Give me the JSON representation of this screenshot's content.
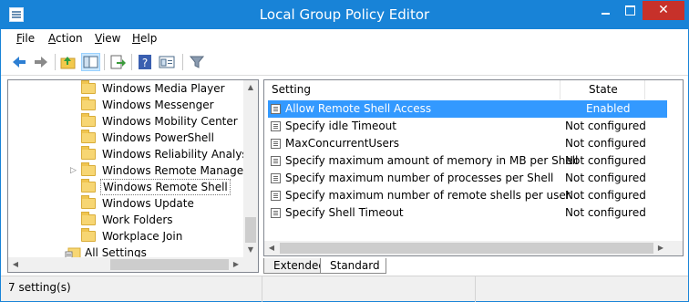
{
  "window": {
    "title": "Local Group Policy Editor",
    "accent": "#1883d7",
    "close_color": "#c7312a"
  },
  "menu": {
    "items": [
      {
        "label": "File",
        "u": "F",
        "rest": "ile"
      },
      {
        "label": "Action",
        "u": "A",
        "rest": "ction"
      },
      {
        "label": "View",
        "u": "V",
        "rest": "iew"
      },
      {
        "label": "Help",
        "u": "H",
        "rest": "elp"
      }
    ]
  },
  "toolbar": {
    "icons": [
      "back-arrow-icon",
      "forward-arrow-icon",
      "up-folder-icon",
      "show-hide-tree-icon",
      "export-list-icon",
      "help-icon",
      "properties-icon",
      "filter-icon"
    ]
  },
  "tree": {
    "items": [
      {
        "label": "Windows Media Player",
        "expandable": false
      },
      {
        "label": "Windows Messenger",
        "expandable": false
      },
      {
        "label": "Windows Mobility Center",
        "expandable": false
      },
      {
        "label": "Windows PowerShell",
        "expandable": false
      },
      {
        "label": "Windows Reliability Analysis",
        "expandable": false
      },
      {
        "label": "Windows Remote Manageme",
        "expandable": true
      },
      {
        "label": "Windows Remote Shell",
        "expandable": false,
        "selected": true
      },
      {
        "label": "Windows Update",
        "expandable": false
      },
      {
        "label": "Work Folders",
        "expandable": false
      },
      {
        "label": "Workplace Join",
        "expandable": false
      }
    ],
    "root": {
      "label": "All Settings"
    }
  },
  "list": {
    "headers": {
      "setting": "Setting",
      "state": "State"
    },
    "rows": [
      {
        "setting": "Allow Remote Shell Access",
        "state": "Enabled",
        "selected": true
      },
      {
        "setting": "Specify idle Timeout",
        "state": "Not configured"
      },
      {
        "setting": "MaxConcurrentUsers",
        "state": "Not configured"
      },
      {
        "setting": "Specify maximum amount of memory in MB per Shell",
        "state": "Not configured"
      },
      {
        "setting": "Specify maximum number of processes per Shell",
        "state": "Not configured"
      },
      {
        "setting": "Specify maximum number of remote shells per user",
        "state": "Not configured"
      },
      {
        "setting": "Specify Shell Timeout",
        "state": "Not configured"
      }
    ]
  },
  "tabs": {
    "extended": "Extended",
    "standard": "Standard",
    "active": "Standard"
  },
  "status": {
    "text": "7 setting(s)"
  }
}
